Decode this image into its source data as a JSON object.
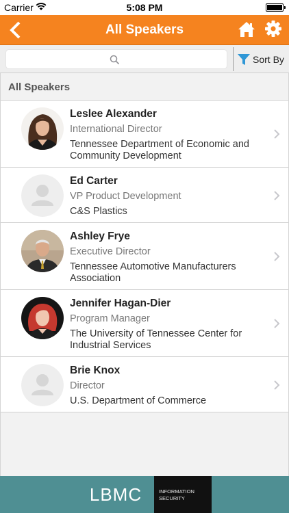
{
  "status_bar": {
    "carrier": "Carrier",
    "time": "5:08 PM"
  },
  "nav": {
    "title": "All Speakers",
    "back_icon": "back-arrow-icon",
    "home_icon": "home-icon",
    "settings_icon": "gear-icon"
  },
  "search": {
    "placeholder": "",
    "value": "",
    "sort_label": "Sort By"
  },
  "section": {
    "header": "All Speakers"
  },
  "speakers": [
    {
      "name": "Leslee Alexander",
      "role": "International Director",
      "org_line1": "Tennessee Department of Economic and",
      "org_line2": "Community Development",
      "photo": "woman-brown-hair"
    },
    {
      "name": "Ed Carter",
      "role": "VP Product Development",
      "org_line1": "C&S Plastics",
      "org_line2": "",
      "photo": "placeholder"
    },
    {
      "name": "Ashley Frye",
      "role": "Executive Director",
      "org_line1": "Tennessee Automotive Manufacturers",
      "org_line2": "Association",
      "photo": "man-grey-hair-suit"
    },
    {
      "name": "Jennifer Hagan-Dier",
      "role": "Program Manager",
      "org_line1": "The University of Tennessee Center for",
      "org_line2": "Industrial Services",
      "photo": "woman-red-hair"
    },
    {
      "name": "Brie Knox",
      "role": "Director",
      "org_line1": "U.S. Department of Commerce",
      "org_line2": "",
      "photo": "placeholder"
    }
  ],
  "banner": {
    "wordmark": "LBMC",
    "tag_line1": "INFORMATION",
    "tag_line2": "SECURITY"
  },
  "colors": {
    "nav_orange": "#f5831f",
    "banner_teal": "#4f8f93",
    "sort_blue": "#2f97d6"
  }
}
